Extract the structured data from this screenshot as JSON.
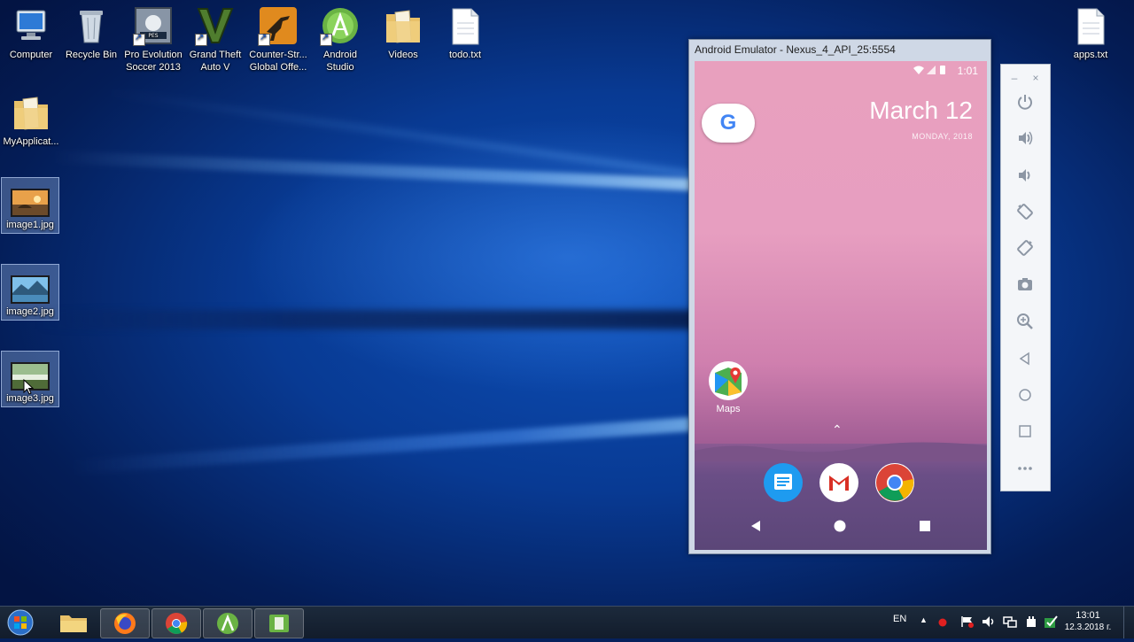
{
  "desktop": {
    "icons": [
      {
        "label": "Computer"
      },
      {
        "label": "Recycle Bin"
      },
      {
        "label": "Pro Evolution Soccer 2013"
      },
      {
        "label": "Grand Theft Auto V"
      },
      {
        "label": "Counter-Str... Global Offe..."
      },
      {
        "label": "Android Studio"
      },
      {
        "label": "Videos"
      },
      {
        "label": "todo.txt"
      },
      {
        "label": "apps.txt"
      },
      {
        "label": "MyApplicat..."
      },
      {
        "label": "image1.jpg"
      },
      {
        "label": "image2.jpg"
      },
      {
        "label": "image3.jpg"
      }
    ]
  },
  "emulator": {
    "title": "Android Emulator - Nexus_4_API_25:5554",
    "status_time": "1:01",
    "date": "March 12",
    "weekday": "MONDAY, 2018",
    "google_letter": "G",
    "maps_label": "Maps",
    "gmail_letter": "M"
  },
  "taskbar": {
    "language": "EN",
    "time": "13:01",
    "date": "12.3.2018 г."
  }
}
